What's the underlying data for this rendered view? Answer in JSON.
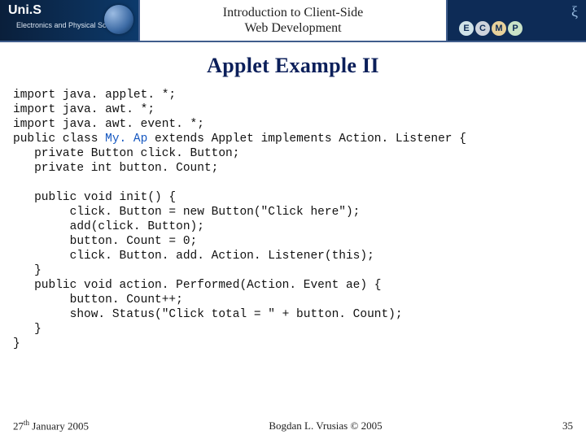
{
  "header": {
    "university": "Uni.S",
    "faculty": "Electronics and\nPhysical Sciences",
    "course_line1": "Introduction to Client-Side",
    "course_line2": "Web Development",
    "letters": {
      "e": "E",
      "c": "C",
      "m": "M",
      "p": "P"
    }
  },
  "title": "Applet Example II",
  "code": {
    "l1": "import java. applet. *;",
    "l2": "import java. awt. *;",
    "l3": "import java. awt. event. *;",
    "l4a": "public class ",
    "l4b": "My. Ap",
    "l4c": " extends Applet implements Action. Listener {",
    "l5": "   private Button click. Button;",
    "l6": "   private int button. Count;",
    "l7": "",
    "l8": "   public void init() {",
    "l9": "        click. Button = new Button(\"Click here\");",
    "l10": "        add(click. Button);",
    "l11": "        button. Count = 0;",
    "l12": "        click. Button. add. Action. Listener(this);",
    "l13": "   }",
    "l14": "   public void action. Performed(Action. Event ae) {",
    "l15": "        button. Count++;",
    "l16": "        show. Status(\"Click total = \" + button. Count);",
    "l17": "   }",
    "l18": "}"
  },
  "footer": {
    "date_day": "27",
    "date_sup": "th",
    "date_rest": " January 2005",
    "author": "Bogdan L. Vrusias © 2005",
    "page": "35"
  }
}
